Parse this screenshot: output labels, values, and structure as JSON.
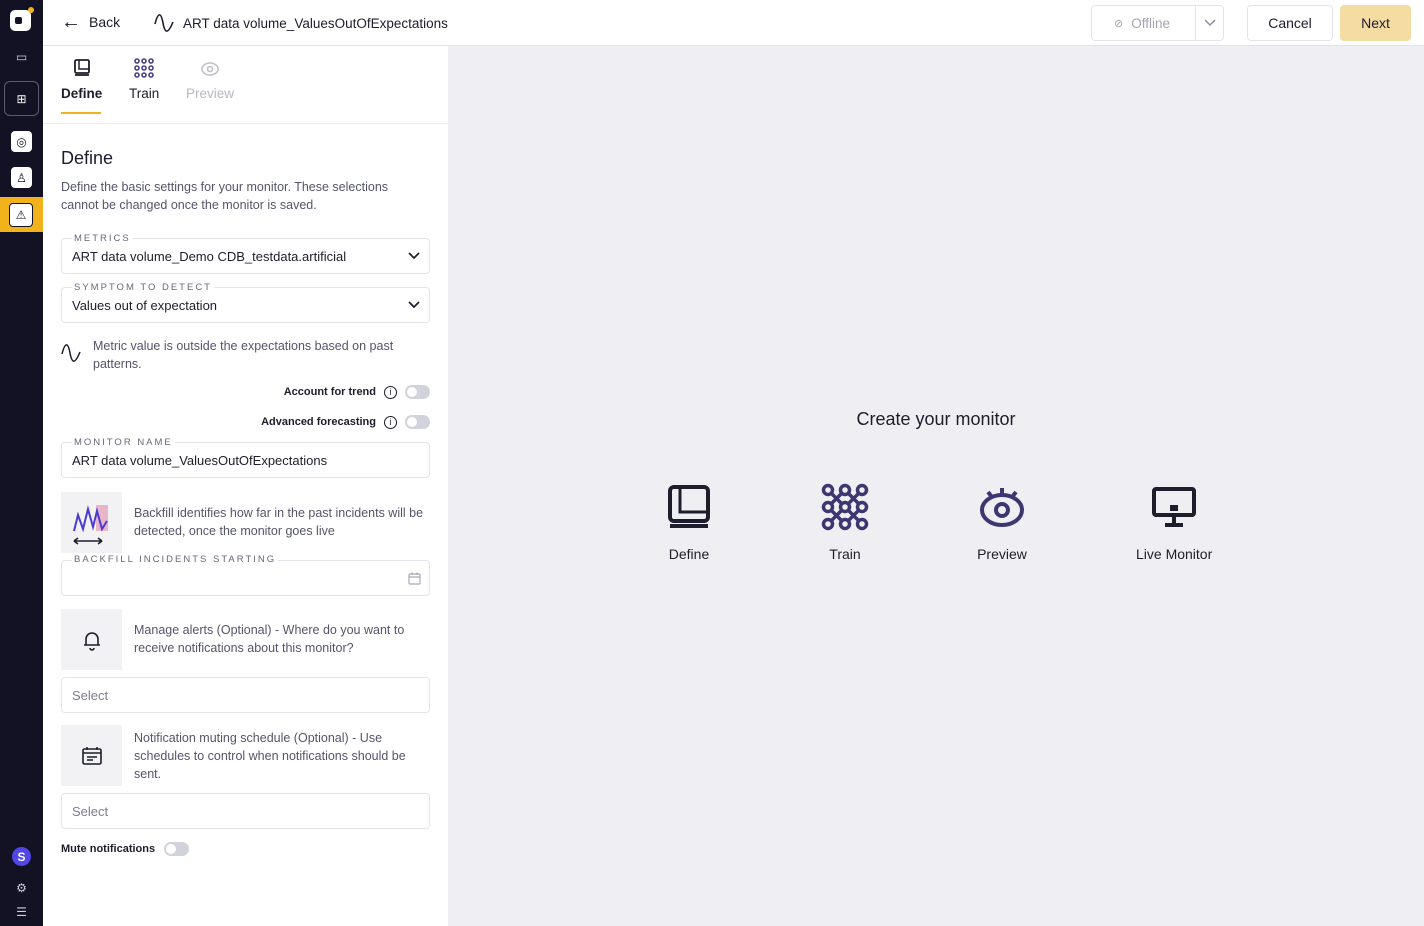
{
  "header": {
    "back_label": "Back",
    "monitor_title": "ART data volume_ValuesOutOfExpectations",
    "status_label": "Offline",
    "cancel_label": "Cancel",
    "next_label": "Next"
  },
  "tabs": [
    {
      "label": "Define",
      "state": "active"
    },
    {
      "label": "Train",
      "state": "enabled"
    },
    {
      "label": "Preview",
      "state": "disabled"
    }
  ],
  "define": {
    "title": "Define",
    "description": "Define the basic settings for your monitor. These selections cannot be changed once the monitor is saved.",
    "metrics": {
      "label": "METRICS",
      "value": "ART data volume_Demo CDB_testdata.artificial"
    },
    "symptom": {
      "label": "SYMPTOM TO DETECT",
      "value": "Values out of expectation"
    },
    "symptom_note": "Metric value is outside the expectations based on past patterns.",
    "account_for_trend": {
      "label": "Account for trend",
      "on": false
    },
    "advanced_forecasting": {
      "label": "Advanced forecasting",
      "on": false
    },
    "monitor_name": {
      "label": "MONITOR NAME",
      "value": "ART data volume_ValuesOutOfExpectations"
    },
    "backfill_note": "Backfill identifies how far in the past incidents will be detected, once the monitor goes live",
    "backfill": {
      "label": "BACKFILL INCIDENTS STARTING",
      "value": ""
    },
    "alerts_note": "Manage alerts (Optional) - Where do you want to receive notifications about this monitor?",
    "alerts_select": {
      "placeholder": "Select"
    },
    "muting_note": "Notification muting schedule (Optional) - Use schedules to control when notifications should be sent.",
    "muting_select": {
      "placeholder": "Select"
    },
    "mute_notifications": {
      "label": "Mute notifications",
      "on": false
    }
  },
  "main": {
    "title": "Create your monitor",
    "steps": [
      "Define",
      "Train",
      "Preview",
      "Live Monitor"
    ]
  },
  "colors": {
    "accent": "#f2b21c",
    "next_button": "#f4dca2",
    "rail": "#121224",
    "step_icon": "#3d3670",
    "avatar": "#5146e6"
  },
  "rail": {
    "avatar_initial": "S"
  }
}
